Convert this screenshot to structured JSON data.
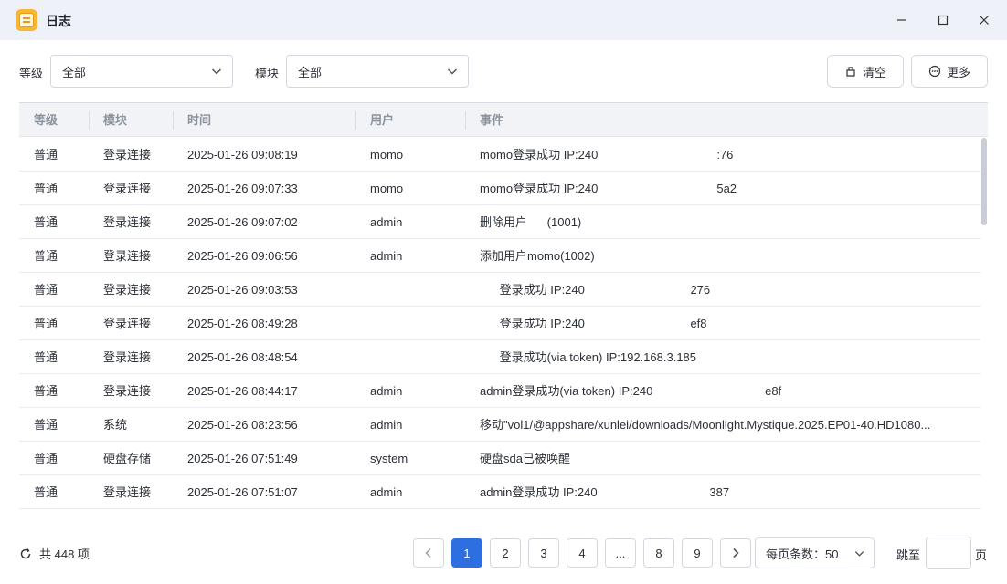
{
  "window": {
    "title": "日志"
  },
  "filters": {
    "level_label": "等级",
    "level_value": "全部",
    "module_label": "模块",
    "module_value": "全部"
  },
  "toolbar": {
    "clear_label": "清空",
    "more_label": "更多"
  },
  "table": {
    "columns": [
      "等级",
      "模块",
      "时间",
      "用户",
      "事件"
    ],
    "rows": [
      {
        "level": "普通",
        "module": "登录连接",
        "time": "2025-01-26 09:08:19",
        "user": "momo",
        "event": "momo登录成功 IP:240                                    :76"
      },
      {
        "level": "普通",
        "module": "登录连接",
        "time": "2025-01-26 09:07:33",
        "user": "momo",
        "event": "momo登录成功 IP:240                                    5a2"
      },
      {
        "level": "普通",
        "module": "登录连接",
        "time": "2025-01-26 09:07:02",
        "user": "admin",
        "event": "删除用户      (1001)"
      },
      {
        "level": "普通",
        "module": "登录连接",
        "time": "2025-01-26 09:06:56",
        "user": "admin",
        "event": "添加用户momo(1002)"
      },
      {
        "level": "普通",
        "module": "登录连接",
        "time": "2025-01-26 09:03:53",
        "user": "",
        "event": "      登录成功 IP:240                                276"
      },
      {
        "level": "普通",
        "module": "登录连接",
        "time": "2025-01-26 08:49:28",
        "user": "",
        "event": "      登录成功 IP:240                                ef8"
      },
      {
        "level": "普通",
        "module": "登录连接",
        "time": "2025-01-26 08:48:54",
        "user": "",
        "event": "      登录成功(via token) IP:192.168.3.185"
      },
      {
        "level": "普通",
        "module": "登录连接",
        "time": "2025-01-26 08:44:17",
        "user": "admin",
        "event": "admin登录成功(via token) IP:240                                  e8f"
      },
      {
        "level": "普通",
        "module": "系统",
        "time": "2025-01-26 08:23:56",
        "user": "admin",
        "event": "移动\"vol1/@appshare/xunlei/downloads/Moonlight.Mystique.2025.EP01-40.HD1080..."
      },
      {
        "level": "普通",
        "module": "硬盘存储",
        "time": "2025-01-26 07:51:49",
        "user": "system",
        "event": "硬盘sda已被唤醒"
      },
      {
        "level": "普通",
        "module": "登录连接",
        "time": "2025-01-26 07:51:07",
        "user": "admin",
        "event": "admin登录成功 IP:240                                  387"
      }
    ]
  },
  "footer": {
    "total_text": "共 448 项",
    "pages": [
      "1",
      "2",
      "3",
      "4",
      "...",
      "8",
      "9"
    ],
    "active_page": "1",
    "page_size_label": "每页条数：50",
    "jump_label": "跳至",
    "jump_suffix": "页"
  },
  "colors": {
    "accent": "#2d6fe0",
    "titlebar_bg": "#eef2f8",
    "app_icon": "#f7b733"
  }
}
